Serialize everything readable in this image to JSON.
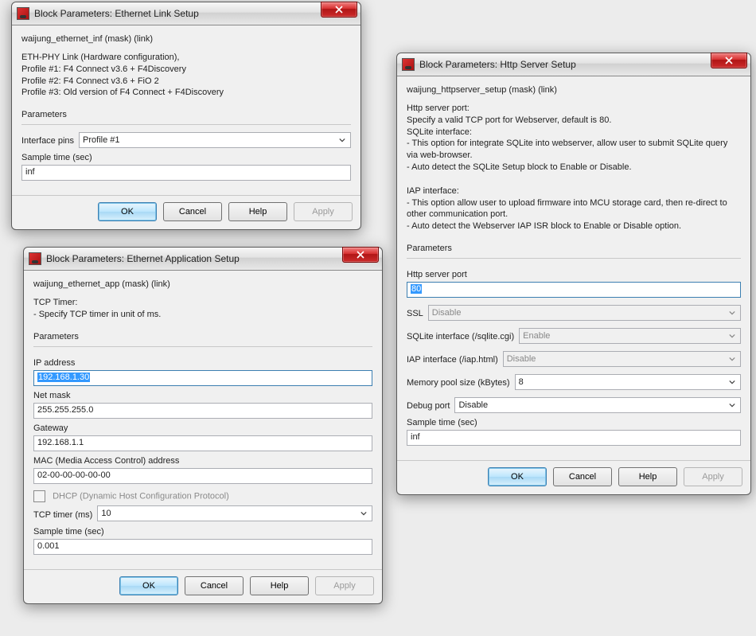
{
  "dlg1": {
    "title": "Block Parameters: Ethernet Link Setup",
    "mask": "waijung_ethernet_inf (mask) (link)",
    "desc": "ETH-PHY Link (Hardware configuration),\nProfile #1: F4 Connect v3.6 + F4Discovery\nProfile #2: F4 Connect v3.6 + FiO 2\nProfile #3: Old version of F4 Connect + F4Discovery",
    "params_label": "Parameters",
    "interface_pins_label": "Interface pins",
    "interface_pins_value": "Profile #1",
    "sample_time_label": "Sample time (sec)",
    "sample_time_value": "inf"
  },
  "dlg2": {
    "title": "Block Parameters: Ethernet Application Setup",
    "mask": "waijung_ethernet_app (mask) (link)",
    "desc": "TCP Timer:\n - Specify TCP timer in unit of ms.",
    "params_label": "Parameters",
    "ip_label": "IP address",
    "ip_value": "192.168.1.30",
    "netmask_label": "Net mask",
    "netmask_value": "255.255.255.0",
    "gateway_label": "Gateway",
    "gateway_value": "192.168.1.1",
    "mac_label": "MAC (Media Access Control) address",
    "mac_value": "02-00-00-00-00-00",
    "dhcp_label": "DHCP (Dynamic Host Configuration Protocol)",
    "tcp_timer_label": "TCP timer (ms)",
    "tcp_timer_value": "10",
    "sample_time_label": "Sample time (sec)",
    "sample_time_value": "0.001"
  },
  "dlg3": {
    "title": "Block Parameters: Http Server Setup",
    "mask": "waijung_httpserver_setup (mask) (link)",
    "desc": "Http server port:\n  Specify a valid TCP port for Webserver, default is 80.\nSQLite interface:\n - This option for integrate SQLite into webserver, allow user to submit SQLite query via web-browser.\n - Auto detect the SQLite Setup block to Enable or Disable.\n\nIAP interface:\n - This option allow user to upload firmware into MCU storage card, then re-direct to other communication port.\n - Auto detect the Webserver IAP ISR block to Enable or Disable option.",
    "params_label": "Parameters",
    "port_label": "Http server port",
    "port_value": "80",
    "ssl_label": "SSL",
    "ssl_value": "Disable",
    "sqlite_label": "SQLite interface (/sqlite.cgi)",
    "sqlite_value": "Enable",
    "iap_label": "IAP interface (/iap.html)",
    "iap_value": "Disable",
    "mem_label": "Memory pool size (kBytes)",
    "mem_value": "8",
    "debug_label": "Debug port",
    "debug_value": "Disable",
    "sample_time_label": "Sample time (sec)",
    "sample_time_value": "inf"
  },
  "buttons": {
    "ok": "OK",
    "cancel": "Cancel",
    "help": "Help",
    "apply": "Apply"
  }
}
